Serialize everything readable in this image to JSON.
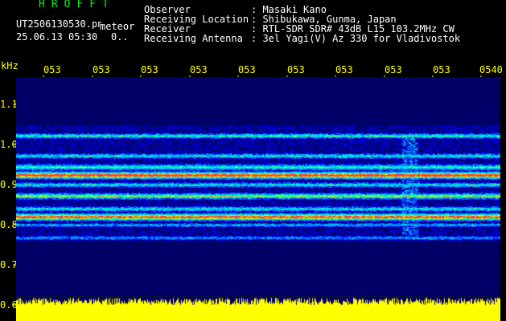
{
  "header": {
    "brand": "HROFFT",
    "filename": "UT2506130530.png",
    "datetime": "25.06.13 05:30",
    "zero_marker": "0..",
    "mode_label": "meteor"
  },
  "info": {
    "labels": [
      "Observer",
      "Receiving Location",
      "Receiver",
      "Receiving Antenna"
    ],
    "values": [
      ": Masaki Kano",
      ": Shibukawa, Gunma, Japan",
      ": RTL-SDR SDR# 43dB L15 103.2MHz CW",
      ": 3el Yagi(V) Az 330 for Vladivostok"
    ]
  },
  "axis": {
    "unit": "kHz",
    "y_ticks": [
      "1.1",
      "1.0",
      "0.9",
      "0.8",
      "0.7",
      "0.6"
    ],
    "x_ticks": [
      "053",
      "053",
      "053",
      "053",
      "053",
      "053",
      "053",
      "053",
      "053",
      "0540"
    ]
  },
  "colors": {
    "text": "#ffffff",
    "brand": "#00ff00",
    "axis_ticks": "#ffff00",
    "plot_bg": "#000066",
    "signal_peak": "#ff3355",
    "activity": "#ffff00"
  }
}
